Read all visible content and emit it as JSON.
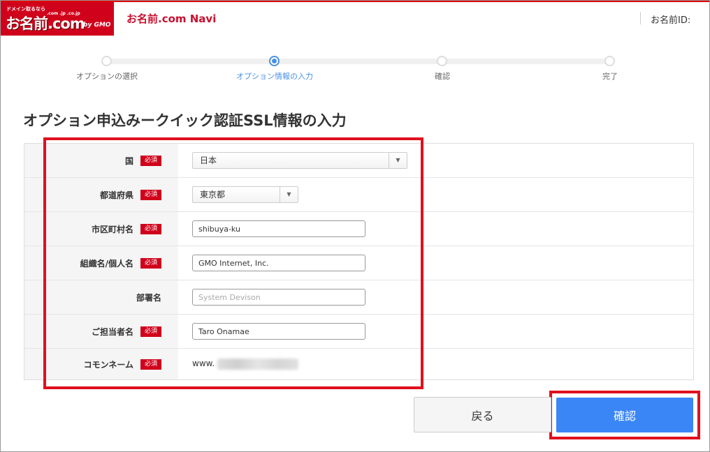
{
  "header": {
    "logo_tagline": "ドメイン取るなら",
    "logo_main": "お名前.com",
    "logo_domains": ".com .jp .co.jp",
    "logo_gmo": "by GMO",
    "app_title": "お名前.com Navi",
    "user_id_label": "お名前ID:"
  },
  "stepper": {
    "steps": [
      {
        "label": "オプションの選択",
        "active": false
      },
      {
        "label": "オプション情報の入力",
        "active": true
      },
      {
        "label": "確認",
        "active": false
      },
      {
        "label": "完了",
        "active": false
      }
    ]
  },
  "page_title": "オプション申込みークイック認証SSL情報の入力",
  "required_badge": "必須",
  "form": {
    "country": {
      "label": "国",
      "value": "日本"
    },
    "prefecture": {
      "label": "都道府県",
      "value": "東京都"
    },
    "city": {
      "label": "市区町村名",
      "value": "shibuya-ku"
    },
    "organization": {
      "label": "組織名/個人名",
      "value": "GMO Internet, Inc."
    },
    "department": {
      "label": "部署名",
      "placeholder": "System Devison"
    },
    "contact": {
      "label": "ご担当者名",
      "value": "Taro Onamae"
    },
    "common_name": {
      "label": "コモンネーム",
      "value": "www."
    }
  },
  "buttons": {
    "back": "戻る",
    "confirm": "確認"
  },
  "colors": {
    "brand_red": "#d0021b",
    "accent_blue": "#3b86f7",
    "highlight_red": "#e0101e"
  }
}
